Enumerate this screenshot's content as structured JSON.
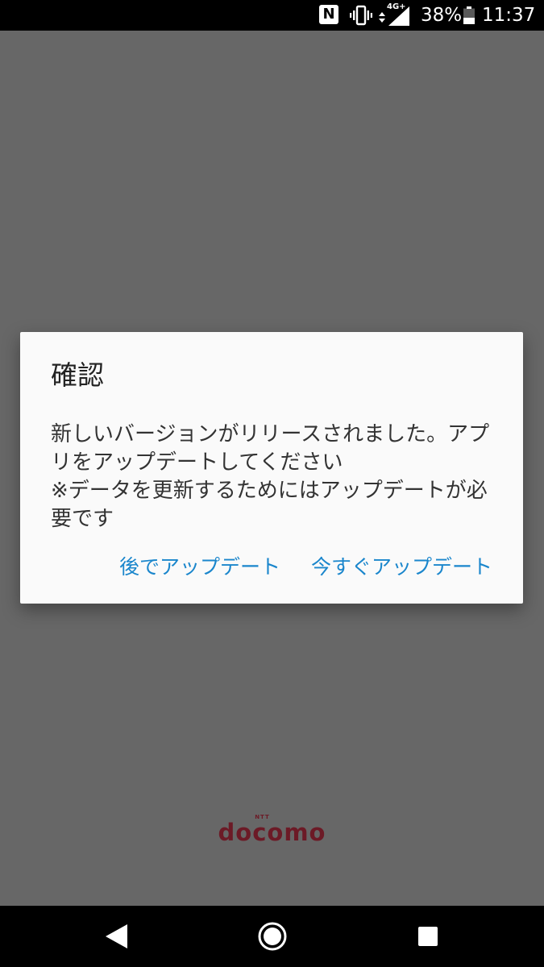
{
  "status_bar": {
    "battery_percent": "38%",
    "time": "11:37",
    "network_label": "4G+",
    "icons": [
      "nfc-icon",
      "vibrate-icon",
      "signal-icon",
      "battery-icon"
    ]
  },
  "dialog": {
    "title": "確認",
    "message_lines": [
      "新しいバージョンがリリースされました。アプリをアップデートしてください",
      "※データを更新するためにはアップデートが必要です"
    ],
    "later_button": "後でアップデート",
    "now_button": "今すぐアップデート"
  },
  "logo": {
    "small_text": "NTT",
    "main_text": "docomo",
    "color": "#6c1a26"
  },
  "nav_bar": {
    "icons": [
      "back-icon",
      "home-icon",
      "recents-icon"
    ]
  },
  "colors": {
    "accent": "#1a86cc",
    "scrim": "#676767",
    "dialog_bg": "#fafafa"
  }
}
